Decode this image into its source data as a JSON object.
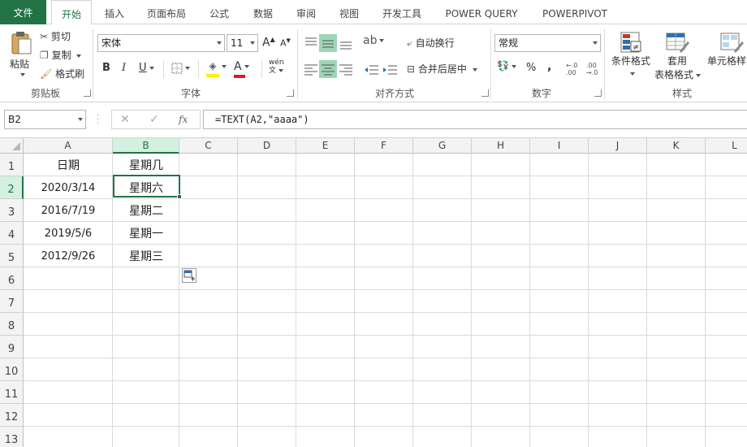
{
  "tabs": [
    "文件",
    "开始",
    "插入",
    "页面布局",
    "公式",
    "数据",
    "审阅",
    "视图",
    "开发工具",
    "POWER QUERY",
    "POWERPIVOT"
  ],
  "ribbon": {
    "clipboard": {
      "paste": "粘贴",
      "cut": "剪切",
      "copy": "复制",
      "format_painter": "格式刷",
      "label": "剪贴板"
    },
    "font": {
      "name": "宋体",
      "size": "11",
      "bold": "B",
      "italic": "I",
      "underline": "U",
      "grow": "A",
      "shrink": "A",
      "font_color": "A",
      "phonetic": "wén",
      "label": "字体"
    },
    "alignment": {
      "wrap": "自动换行",
      "merge": "合并后居中",
      "label": "对齐方式"
    },
    "number": {
      "format": "常规",
      "percent": "%",
      "comma": ",",
      "label": "数字"
    },
    "styles": {
      "conditional": "条件格式",
      "table_fmt_1": "套用",
      "table_fmt_2": "表格格式",
      "cell_styles": "单元格样式",
      "label": "样式"
    }
  },
  "formula_bar": {
    "name_box": "B2",
    "cancel": "✕",
    "enter": "✓",
    "fx": "fx",
    "formula": "=TEXT(A2,\"aaaa\")"
  },
  "grid": {
    "columns": [
      "A",
      "B",
      "C",
      "D",
      "E",
      "F",
      "G",
      "H",
      "I",
      "J",
      "K",
      "L"
    ],
    "rows": [
      "1",
      "2",
      "3",
      "4",
      "5",
      "6",
      "7",
      "8",
      "9",
      "10",
      "11",
      "12",
      "13"
    ],
    "cells": {
      "A1": "日期",
      "B1": "星期几",
      "A2": "2020/3/14",
      "B2": "星期六",
      "A3": "2016/7/19",
      "B3": "星期二",
      "A4": "2019/5/6",
      "B4": "星期一",
      "A5": "2012/9/26",
      "B5": "星期三"
    }
  },
  "colors": {
    "accent": "#217346",
    "selected_header": "#d3f0e0",
    "align_highlight": "#9fd5b7"
  }
}
